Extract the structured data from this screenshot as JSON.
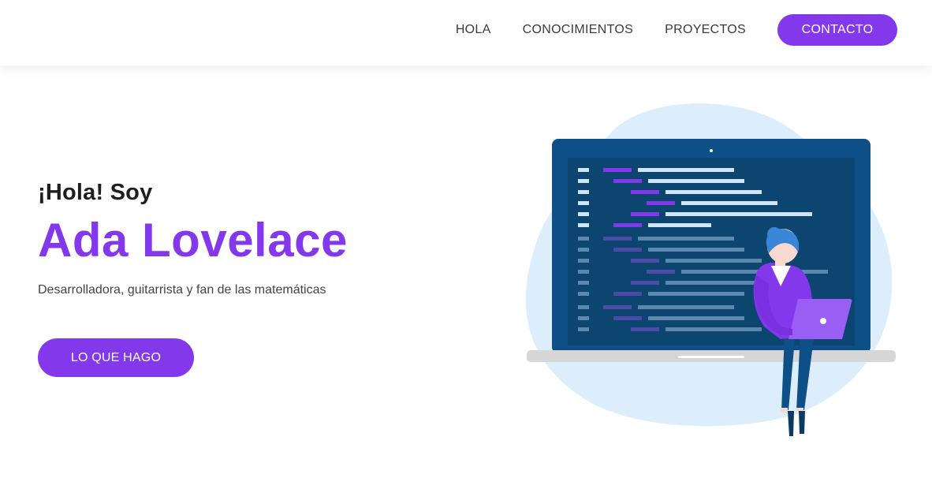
{
  "nav": {
    "links": [
      {
        "label": "HOLA"
      },
      {
        "label": "CONOCIMIENTOS"
      },
      {
        "label": "PROYECTOS"
      }
    ],
    "cta_label": "CONTACTO"
  },
  "hero": {
    "greeting": "¡Hola! Soy",
    "name": "Ada Lovelace",
    "tagline": "Desarrolladora, guitarrista y fan de las matemáticas",
    "button_label": "LO QUE HAGO"
  },
  "colors": {
    "accent": "#8338ec",
    "text_dark": "#1f1f1f",
    "blob": "#dcedfc",
    "screen_frame": "#0d4f86",
    "screen_bg": "#0b4570"
  },
  "illustration": {
    "icon": "developer-laptop-illustration"
  }
}
